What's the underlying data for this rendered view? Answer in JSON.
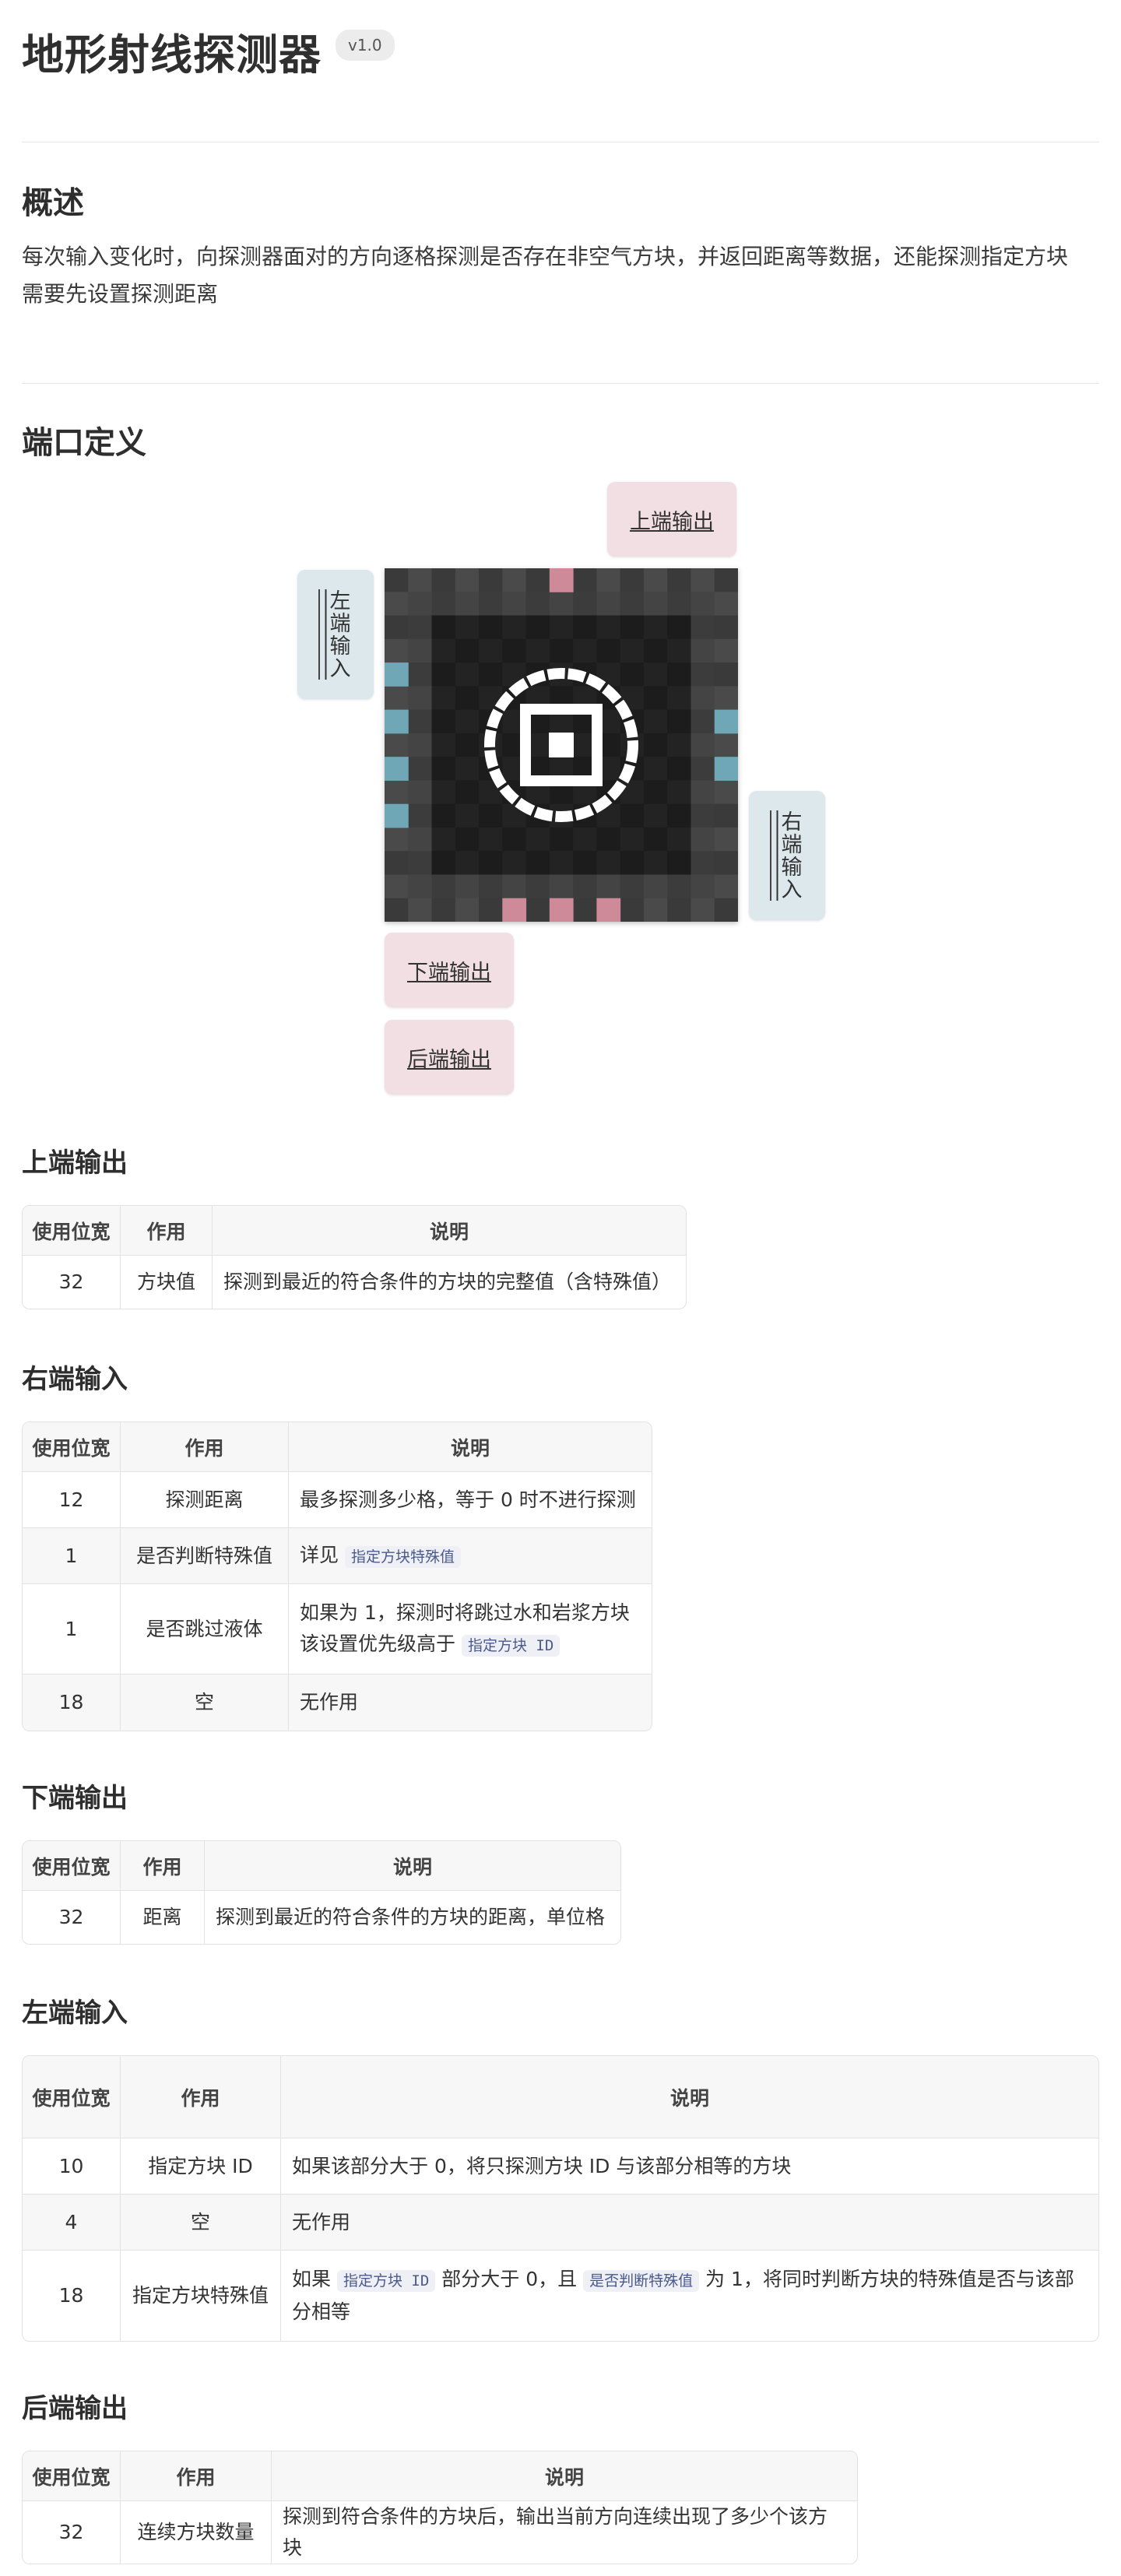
{
  "header": {
    "title": "地形射线探测器",
    "version": "v1.0"
  },
  "overview": {
    "heading": "概述",
    "line1": "每次输入变化时，向探测器面对的方向逐格探测是否存在非空气方块，并返回距离等数据，还能探测指定方块",
    "line2": "需要先设置探测距离"
  },
  "ports": {
    "heading": "端口定义",
    "top": "上端输出",
    "left": "左端输入",
    "right": "右端输入",
    "bottom": "下端输出",
    "back": "后端输出"
  },
  "colors": {
    "output": "#f1dfe3",
    "input": "#dce8ec",
    "pin_pink": "#cf8a9a",
    "pin_blue": "#6fa7b7"
  },
  "tables": {
    "top": {
      "heading": "上端输出",
      "headers": [
        "使用位宽",
        "作用",
        "说明"
      ],
      "rows": [
        [
          "32",
          "方块值",
          "探测到最近的符合条件的方块的完整值（含特殊值）"
        ]
      ]
    },
    "right": {
      "heading": "右端输入",
      "headers": [
        "使用位宽",
        "作用",
        "说明"
      ],
      "r1": [
        "12",
        "探测距离",
        "最多探测多少格，等于 0 时不进行探测"
      ],
      "r2": [
        "1",
        "是否判断特殊值",
        "详见",
        "指定方块特殊值"
      ],
      "r3": [
        "1",
        "是否跳过液体",
        "如果为 1，探测时将跳过水和岩浆方块",
        "该设置优先级高于",
        "指定方块 ID"
      ],
      "r4": [
        "18",
        "空",
        "无作用"
      ]
    },
    "bottom": {
      "heading": "下端输出",
      "headers": [
        "使用位宽",
        "作用",
        "说明"
      ],
      "rows": [
        [
          "32",
          "距离",
          "探测到最近的符合条件的方块的距离，单位格"
        ]
      ]
    },
    "left": {
      "heading": "左端输入",
      "headers": [
        "使用位宽",
        "作用",
        "说明"
      ],
      "r1": [
        "10",
        "指定方块 ID",
        "如果该部分大于 0，将只探测方块 ID 与该部分相等的方块"
      ],
      "r2": [
        "4",
        "空",
        "无作用"
      ],
      "r3": [
        "18",
        "指定方块特殊值",
        "如果",
        "指定方块 ID",
        "部分大于 0，且",
        "是否判断特殊值",
        "为 1，将同时判断方块的特殊值是否与该部分相等"
      ]
    },
    "back": {
      "heading": "后端输出",
      "headers": [
        "使用位宽",
        "作用",
        "说明"
      ],
      "rows": [
        [
          "32",
          "连续方块数量",
          "探测到符合条件的方块后，输出当前方向连续出现了多少个该方块"
        ]
      ]
    }
  }
}
